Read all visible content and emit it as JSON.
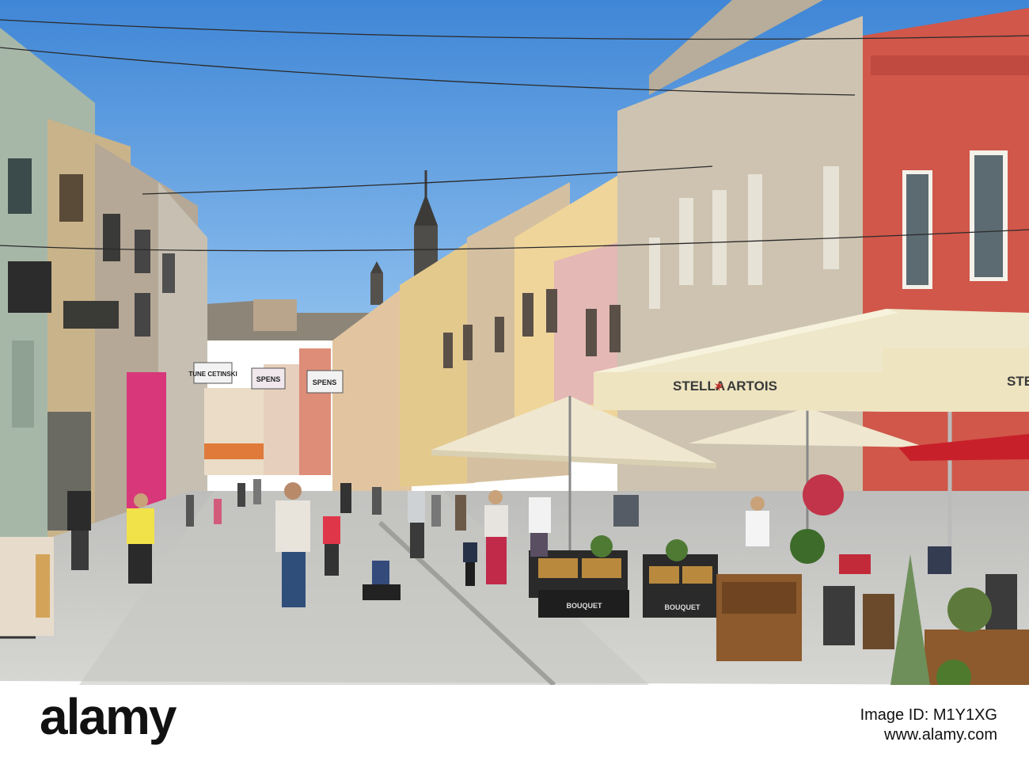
{
  "photo": {
    "umbrella_brand_left": "STELLA",
    "umbrella_brand_star": "✶",
    "umbrella_brand_right": "ARTOIS",
    "umbrella_brand_cut": "STE",
    "planter_label_left": "BOUQUET",
    "planter_label_right": "BOUQUET",
    "banner_1": "TUNE CETINSKI",
    "banner_2": "SPENS",
    "banner_3": "SPENS"
  },
  "footer": {
    "logo": "alamy",
    "image_id_label": "Image ID: M1Y1XG",
    "site": "www.alamy.com"
  },
  "colors": {
    "sky": "#4a8fd9",
    "pavement": "#cfcfcd",
    "red_building": "#d0574a",
    "umbrella": "#eee7c9",
    "planter_black": "#1e1e1e"
  }
}
